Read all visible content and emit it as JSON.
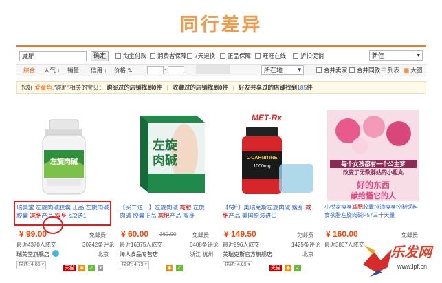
{
  "header": {
    "title": "同行差异"
  },
  "search": {
    "query": "减肥",
    "confirm": "确定",
    "filters": [
      "淘宝付款",
      "消费者保障",
      "7天退换",
      "正品保障",
      "旺旺在线",
      "折扣促销"
    ],
    "sort_select": "新佳"
  },
  "sortbar": {
    "items": [
      "综合",
      "人气",
      "销量",
      "信用",
      "价格"
    ],
    "location": "所在地",
    "merge_shop": "合并卖家",
    "merge_same": "合并同款",
    "view_list": "列表",
    "view_grid": "大图"
  },
  "notice": {
    "p1": "您好",
    "user": "爱童鱼",
    "p2": ",\"减肥\"相关的宝贝：",
    "p3": "购买过的店铺找到0件",
    "p4": "收藏过的店铺找到0件",
    "p5": "好友共享过的店铺找到",
    "count": "185",
    "p6": "件"
  },
  "products": [
    {
      "title_parts": [
        "瑞美堂 左旋肉碱胶囊 正品 左旋肉碱 胶囊 ",
        "减肥",
        "产品 ",
        "瘦身",
        " 买2送1"
      ],
      "price": "¥ 99.00",
      "shipping": "免邮费",
      "sales": "最近4370人成交",
      "reviews": "30242条评论",
      "shop": "瑞美堂旗舰店",
      "location": "北京",
      "dsr": "描述: 4.86"
    },
    {
      "title_parts": [
        "【买二送一】左旋肉碱 ",
        "减肥",
        " 左旋肉碱 胶囊正品 ",
        "减肥",
        "产品 瘦身"
      ],
      "price": "¥ 60.00",
      "orig_price": "160.00",
      "shipping": "免邮费",
      "sales": "最近16375人成交",
      "reviews": "6408条评论",
      "shop": "淘人食品专营店",
      "location": "浙江 杭州",
      "dsr": "描述: 4.79"
    },
    {
      "title_parts": [
        "【5折】美瑞克斯左旋肉碱 瘦身 ",
        "减肥",
        "产品 美国原装进口"
      ],
      "price": "¥ 149.50",
      "shipping": "免邮费",
      "sales": "最近996人成交",
      "reviews": "1425条评论",
      "shop": "美瑞克斯官方旗舰店",
      "location": "北京",
      "dsr": "描述: 4.89"
    },
    {
      "title_parts": [
        "小悦家瘦身",
        "减肥",
        "胶囊排油瘦身控制饲料 食欲胎左旋肉碱P57三十天量"
      ],
      "price": "¥ 160.00",
      "shipping": "免邮费",
      "sales": "最近3867人成交",
      "reviews": "",
      "shop": "",
      "location": "",
      "dsr": ""
    }
  ],
  "product_images": {
    "p1_label": "左旋肉碱",
    "p2_label": "左旋肉碱",
    "p3_brand": "MET-Rx",
    "p3_label": "L-CARNITINE",
    "p3_dose": "1000mg",
    "p4_line1": "每个女孩都有一个公主梦",
    "p4_line2": "改变了无数胖姑的小粗丸",
    "p4_line3": "好的东西",
    "p4_line4": "献给懂它的人"
  },
  "watermark": {
    "text": "乐发网",
    "url": "www.lpf.cn"
  },
  "colors": {
    "accent": "#f27b1f",
    "title": "#f29a4a",
    "link": "#3366cc",
    "price": "#ff4400",
    "highlight": "#cc0000"
  }
}
